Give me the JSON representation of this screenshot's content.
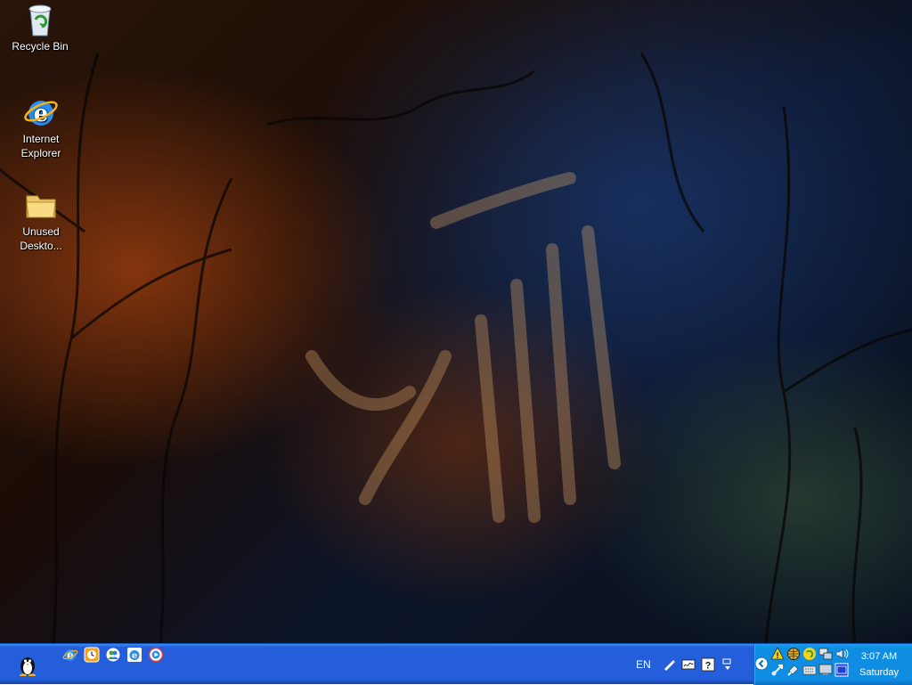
{
  "desktop": {
    "icons": [
      {
        "label": "Recycle Bin",
        "icon": "recycle-bin-icon"
      },
      {
        "label": "Internet\nExplorer",
        "icon": "internet-explorer-icon"
      },
      {
        "label": "Unused\nDeskto...",
        "icon": "folder-icon"
      }
    ]
  },
  "taskbar": {
    "start_icon": "penguin-icon",
    "quick_launch": [
      {
        "icon": "internet-explorer-icon"
      },
      {
        "icon": "clock-app-icon"
      },
      {
        "icon": "messenger-icon"
      },
      {
        "icon": "ie-update-icon"
      },
      {
        "icon": "media-player-icon"
      }
    ],
    "language_bar": {
      "language": "EN",
      "icons": [
        "pen-tool-icon",
        "handwriting-icon",
        "help-icon",
        "options-icon"
      ]
    },
    "tray": {
      "icons": [
        "network-warning-icon",
        "globe-icon",
        "recycle-tray-icon",
        "monitor-network-icon",
        "speaker-icon",
        "safely-remove-icon",
        "usb-icon",
        "keyboard-icon",
        "display-icon",
        "blue-window-icon"
      ],
      "time": "3:07 AM",
      "day": "Saturday"
    }
  },
  "colors": {
    "taskbar_blue": "#245edb",
    "tray_blue": "#0f8de3"
  }
}
